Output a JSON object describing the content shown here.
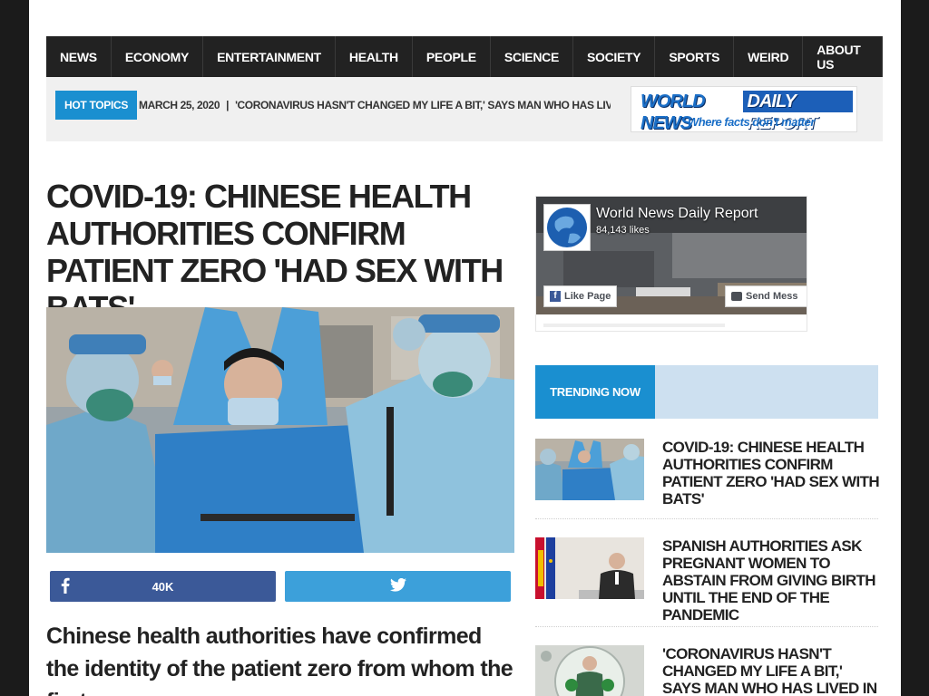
{
  "nav": {
    "items": [
      "NEWS",
      "ECONOMY",
      "ENTERTAINMENT",
      "HEALTH",
      "PEOPLE",
      "SCIENCE",
      "SOCIETY",
      "SPORTS",
      "WEIRD",
      "ABOUT US"
    ]
  },
  "topbar": {
    "hot_label": "HOT TOPICS",
    "date": "MARCH 25, 2020",
    "separator": "|",
    "headline": "'CORONAVIRUS HASN'T CHANGED MY LIFE A BIT,' SAYS MAN WHO HAS LIVED"
  },
  "logo": {
    "part1": "WORLD NEWS",
    "part2": "DAILY REPORT",
    "tagline": "Where facts don't matter"
  },
  "article": {
    "title": "COVID-19: CHINESE HEALTH AUTHORITIES CONFIRM PATIENT ZERO 'HAD SEX WITH BATS'",
    "facebook_count": "40K",
    "lead": "Chinese health authorities have confirmed the identity of the patient zero from whom the first"
  },
  "facebook_widget": {
    "page_name": "World News Daily Report",
    "likes": "84,143 likes",
    "like_button": "Like Page",
    "message_button": "Send Mess"
  },
  "trending": {
    "label": "TRENDING NOW",
    "items": [
      {
        "title": "COVID-19: CHINESE HEALTH AUTHORITIES CONFIRM PATIENT ZERO 'HAD SEX WITH BATS'"
      },
      {
        "title": "SPANISH AUTHORITIES ASK PREGNANT WOMEN TO ABSTAIN FROM GIVING BIRTH UNTIL THE END OF THE PANDEMIC"
      },
      {
        "title": "'CORONAVIRUS HASN'T CHANGED MY LIFE A BIT,' SAYS MAN WHO HAS LIVED IN BUBBLE SUIT SINCE"
      }
    ]
  },
  "colors": {
    "nav_bg": "#222222",
    "accent": "#1a8fd0",
    "facebook": "#3b5998",
    "twitter": "#3ca0da",
    "trending_bar": "#cde0f0"
  }
}
